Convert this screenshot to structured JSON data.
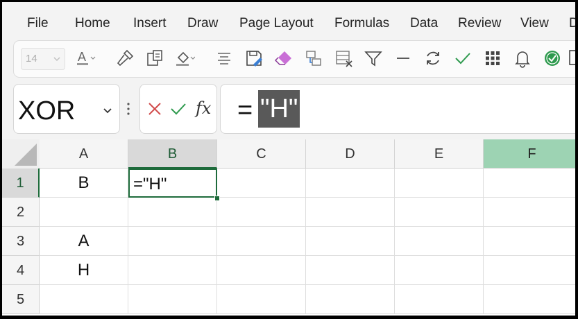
{
  "menu": [
    "File",
    "Home",
    "Insert",
    "Draw",
    "Page Layout",
    "Formulas",
    "Data",
    "Review",
    "View",
    "D"
  ],
  "toolbar": {
    "font_size": "14",
    "icons": [
      "font-color-icon",
      "format-painter-icon",
      "paste-special-icon",
      "fill-color-icon",
      "align-icon",
      "save-edit-icon",
      "eraser-icon",
      "copy-format-icon",
      "clear-format-icon",
      "filter-icon",
      "minus-icon",
      "refresh-icon",
      "check-icon",
      "grid-icon",
      "bell-icon",
      "accept-icon",
      "more-icon"
    ]
  },
  "name_box": "XOR",
  "formula": {
    "prefix": "=",
    "selected": "\"H\""
  },
  "columns": [
    "A",
    "B",
    "C",
    "D",
    "E",
    "F"
  ],
  "rows": [
    "1",
    "2",
    "3",
    "4",
    "5"
  ],
  "cells": {
    "A1": "B",
    "B1": "=\"H\"",
    "A3": "A",
    "A4": "H"
  },
  "colors": {
    "accent": "#1e6b3b",
    "green_header": "#9dd3b3",
    "selection": "#595959"
  }
}
